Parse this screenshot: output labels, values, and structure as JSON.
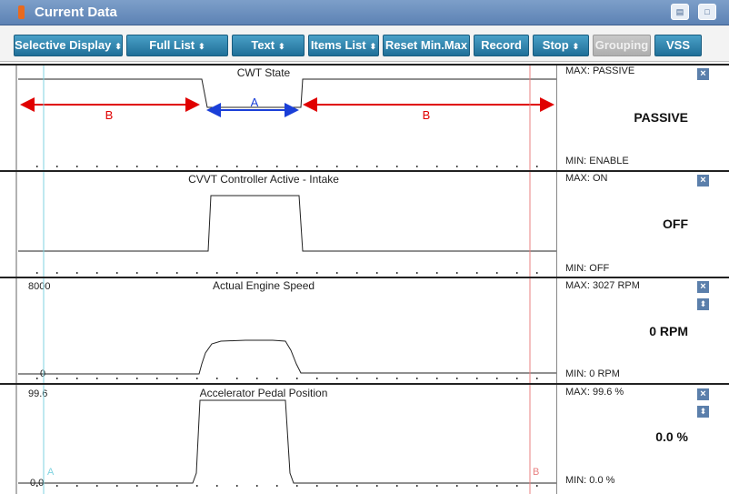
{
  "window": {
    "title": "Current Data"
  },
  "toolbar": {
    "selective_display": "Selective Display",
    "full_list": "Full List",
    "text": "Text",
    "items_list": "Items List",
    "reset_min_max": "Reset Min.Max",
    "record": "Record",
    "stop": "Stop",
    "grouping": "Grouping",
    "vss": "VSS"
  },
  "graphs": [
    {
      "title": "CWT State",
      "max_label": "MAX: PASSIVE",
      "min_label": "MIN: ENABLE",
      "value": "PASSIVE"
    },
    {
      "title": "CVVT Controller Active - Intake",
      "max_label": "MAX: ON",
      "min_label": "MIN: OFF",
      "value": "OFF"
    },
    {
      "title": "Actual Engine Speed",
      "y_max": "8000",
      "y_min": "0",
      "max_label": "MAX:   3027 RPM",
      "min_label": "MIN:     0 RPM",
      "value": "0 RPM"
    },
    {
      "title": "Accelerator Pedal Position",
      "y_max": "99.6",
      "y_min": "0.0",
      "max_label": "MAX:   99.6 %",
      "min_label": "MIN:   0.0 %",
      "value": "0.0 %"
    }
  ],
  "annotations": {
    "a": "A",
    "b": "B",
    "cursor_a": "A",
    "cursor_b": "B"
  },
  "colors": {
    "accent": "#1f6f98",
    "cursor_a": "#7fd3e0",
    "cursor_b": "#e88080",
    "arrow_red": "#e00000",
    "arrow_blue": "#1a3fd8"
  }
}
